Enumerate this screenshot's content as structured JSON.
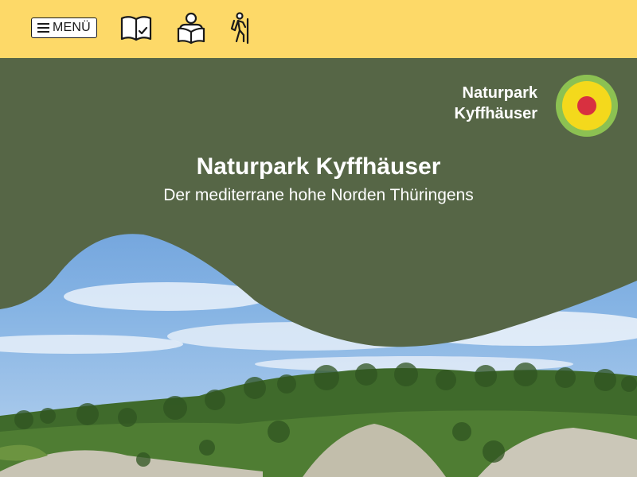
{
  "header": {
    "menu_label": "MENÜ",
    "icons": [
      "book-check-icon",
      "reader-icon",
      "hiker-icon"
    ]
  },
  "brand": {
    "line1": "Naturpark",
    "line2": "Kyffhäuser"
  },
  "hero": {
    "title": "Naturpark Kyffhäuser",
    "subtitle": "Der mediterrane hohe Norden Thüringens"
  },
  "colors": {
    "header_bg": "#fdd968",
    "hero_green": "#566646",
    "logo_outer": "#8cc152",
    "logo_middle": "#f4d91c",
    "logo_center": "#d83040",
    "sky": "#6fa2db"
  }
}
